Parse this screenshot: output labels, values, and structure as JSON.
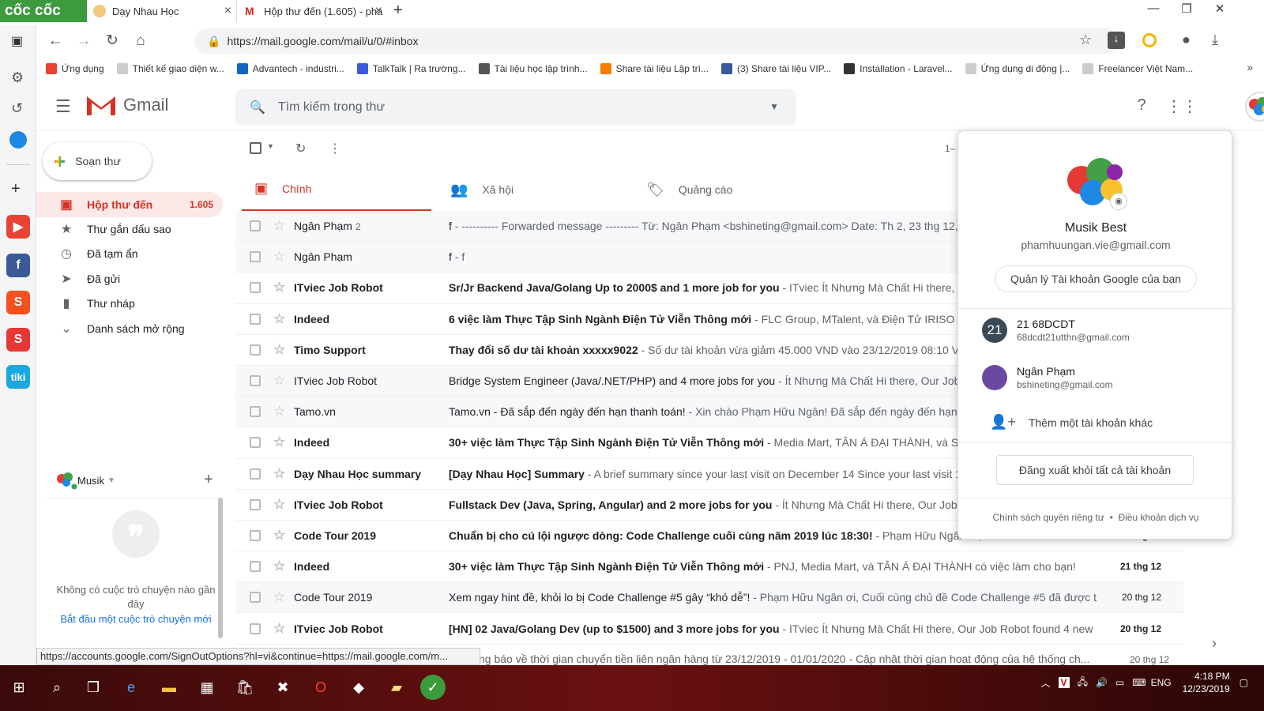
{
  "browser": {
    "brand": "cốc cốc",
    "tabs": [
      {
        "title": "Dạy Nhau Học"
      },
      {
        "title": "Hộp thư đến (1.605) - pha"
      }
    ],
    "url": "https://mail.google.com/mail/u/0/#inbox",
    "bookmarks": [
      {
        "label": "Ứng dụng",
        "color": "#e94235"
      },
      {
        "label": "Thiết kế giao diện w...",
        "color": "#cccccc"
      },
      {
        "label": "Advantech - industri...",
        "color": "#1565c0"
      },
      {
        "label": "TalkTalk | Ra trường...",
        "color": "#3b5bdb"
      },
      {
        "label": "Tài liệu học lập trình...",
        "color": "#555555"
      },
      {
        "label": "Share tài liệu Lập trì...",
        "color": "#f57c00"
      },
      {
        "label": "(3) Share tài liệu VIP...",
        "color": "#3b5998"
      },
      {
        "label": "Installation - Laravel...",
        "color": "#333333"
      },
      {
        "label": "Ứng dụng di động |...",
        "color": "#cccccc"
      },
      {
        "label": "Freelancer Việt Nam...",
        "color": "#cccccc"
      }
    ],
    "status_url": "https://accounts.google.com/SignOutOptions?hl=vi&continue=https://mail.google.com/m..."
  },
  "gmail": {
    "logo_text": "Gmail",
    "search_placeholder": "Tìm kiếm trong thư",
    "compose_label": "Soạn thư",
    "nav": [
      {
        "label": "Hộp thư đến",
        "count": "1.605",
        "icon": "inbox-icon",
        "active": true
      },
      {
        "label": "Thư gắn dấu sao",
        "count": "",
        "icon": "star-icon"
      },
      {
        "label": "Đã tạm ẩn",
        "count": "",
        "icon": "clock-icon"
      },
      {
        "label": "Đã gửi",
        "count": "",
        "icon": "send-icon"
      },
      {
        "label": "Thư nháp",
        "count": "",
        "icon": "draft-icon"
      },
      {
        "label": "Danh sách mở rộng",
        "count": "",
        "icon": "chevron-down-icon"
      }
    ],
    "chat": {
      "user": "Musik",
      "no_chats": "Không có cuộc trò chuyện nào gần đây",
      "start_chat": "Bắt đầu một cuộc trò chuyện mới"
    },
    "page_indicator": "1–",
    "category_tabs": [
      {
        "label": "Chính",
        "icon": "inbox-icon"
      },
      {
        "label": "Xã hội",
        "icon": "people-icon"
      },
      {
        "label": "Quảng cáo",
        "icon": "tag-icon"
      }
    ],
    "emails": [
      {
        "sender": "Ngân Phạm",
        "count": "2",
        "subject": "f",
        "snippet": " - ---------- Forwarded message --------- Từ: Ngân Phạm <bshineting@gmail.com> Date: Th 2, 23 thg 12, 20",
        "date": "",
        "unread": false
      },
      {
        "sender": "Ngân Phạm",
        "count": "",
        "subject": "f",
        "snippet": " - f",
        "date": "",
        "unread": false
      },
      {
        "sender": "ITviec Job Robot",
        "count": "",
        "subject": "Sr/Jr Backend Java/Golang Up to 2000$ and 1 more job for you",
        "snippet": " - ITviec Ít Nhưng Mà Chất Hi there, Our",
        "date": "",
        "unread": true
      },
      {
        "sender": "Indeed",
        "count": "",
        "subject": "6 việc làm Thực Tập Sinh Ngành Điện Tử Viễn Thông mới",
        "snippet": " - FLC Group, MTalent, và Điện Tử IRISO VIỆT",
        "date": "",
        "unread": true
      },
      {
        "sender": "Timo Support",
        "count": "",
        "subject": "Thay đổi số dư tài khoản xxxxx9022",
        "snippet": " - Số dư tài khoản vừa giảm 45.000 VND vào 23/12/2019 08:10 VN",
        "date": "",
        "unread": true
      },
      {
        "sender": "ITviec Job Robot",
        "count": "",
        "subject": "Bridge System Engineer (Java/.NET/PHP) and 4 more jobs for you",
        "snippet": " - Ít Nhưng Mà Chất Hi there, Our Job",
        "date": "",
        "unread": false
      },
      {
        "sender": "Tamo.vn",
        "count": "",
        "subject": "Tamo.vn - Đã sắp đến ngày đến hạn thanh toán!",
        "snippet": " - Xin chào Phạm Hữu Ngân! Đã sắp đến ngày đến hạn t",
        "date": "",
        "unread": false
      },
      {
        "sender": "Indeed",
        "count": "",
        "subject": "30+ việc làm Thực Tập Sinh Ngành Điện Tử Viễn Thông mới",
        "snippet": " - Media Mart, TÂN Á ĐẠI THÀNH, và SAO V",
        "date": "",
        "unread": true
      },
      {
        "sender": "Dạy Nhau Học summary",
        "count": "",
        "subject": "[Dạy Nhau Học] Summary",
        "snippet": " - A brief summary since your last visit on December 14 Since your last visit 1",
        "date": "",
        "unread": true
      },
      {
        "sender": "ITviec Job Robot",
        "count": "",
        "subject": "Fullstack Dev (Java, Spring, Angular) and 2 more jobs for you",
        "snippet": " - Ít Nhưng Mà Chất Hi there, Our Job Rob",
        "date": "",
        "unread": true
      },
      {
        "sender": "Code Tour 2019",
        "count": "",
        "subject": "Chuẩn bị cho cú lội ngược dòng: Code Challenge cuối cùng năm 2019 lúc 18:30!",
        "snippet": " - Phạm Hữu Ngân ơi,",
        "date": "21 thg 12",
        "unread": true
      },
      {
        "sender": "Indeed",
        "count": "",
        "subject": "30+ việc làm Thực Tập Sinh Ngành Điện Tử Viễn Thông mới",
        "snippet": " - PNJ, Media Mart, và TÂN Á ĐẠI THÀNH có việc làm cho bạn!",
        "date": "21 thg 12",
        "unread": true
      },
      {
        "sender": "Code Tour 2019",
        "count": "",
        "subject": "Xem ngay hint đề, khỏi lo bị Code Challenge #5 gây “khó dễ”!",
        "snippet": " - Phạm Hữu Ngân ơi, Cuối cùng chủ đề Code Challenge #5 đã được t...",
        "date": "20 thg 12",
        "unread": false
      },
      {
        "sender": "ITviec Job Robot",
        "count": "",
        "subject": "[HN] 02 Java/Golang Dev (up to $1500) and 3 more jobs for you",
        "snippet": " - ITviec Ít Nhưng Mà Chất Hi there, Our Job Robot found 4 new L...",
        "date": "20 thg 12",
        "unread": true
      }
    ],
    "last_row_text": "ng báo về thời gian chuyển tiền liên ngân hàng từ 23/12/2019 - 01/01/2020 - Cập nhật thời gian hoạt động của hệ thống ch...",
    "last_row_date": "20 thg 12"
  },
  "account_popup": {
    "name": "Musik Best",
    "email": "phamhuungan.vie@gmail.com",
    "manage_label": "Quản lý Tài khoản Google của bạn",
    "accounts": [
      {
        "initials": "21",
        "name": "21 68DCDT",
        "email": "68dcdt21utthn@gmail.com",
        "color": "#3c4a56"
      },
      {
        "initials": "",
        "name": "Ngân Phạm",
        "email": "bshineting@gmail.com",
        "color": "#6a4aa0"
      }
    ],
    "add_account_label": "Thêm một tài khoản khác",
    "signout_label": "Đăng xuất khỏi tất cả tài khoản",
    "privacy_label": "Chính sách quyền riêng tư",
    "separator": "•",
    "terms_label": "Điều khoản dịch vụ"
  },
  "taskbar": {
    "language": "ENG",
    "time": "4:18 PM",
    "date": "12/23/2019"
  }
}
